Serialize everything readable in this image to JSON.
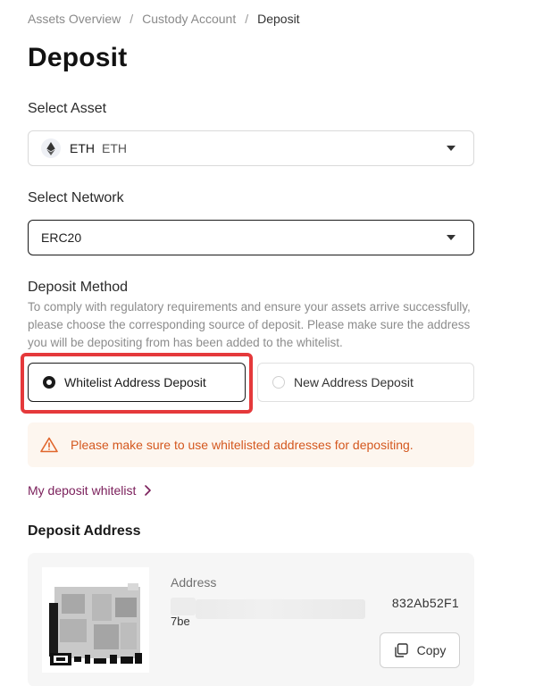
{
  "breadcrumb": {
    "items": [
      "Assets Overview",
      "Custody Account",
      "Deposit"
    ],
    "separator": "/"
  },
  "page": {
    "title": "Deposit"
  },
  "select_asset": {
    "label": "Select Asset",
    "symbol": "ETH",
    "name": "ETH",
    "icon": "ethereum-icon"
  },
  "select_network": {
    "label": "Select Network",
    "value": "ERC20"
  },
  "deposit_method": {
    "label": "Deposit Method",
    "description": "To comply with regulatory requirements and ensure your assets arrive successfully, please choose the corresponding source of deposit. Please make sure the address you will be depositing from has been added to the whitelist.",
    "options": [
      {
        "label": "Whitelist Address Deposit",
        "selected": true
      },
      {
        "label": "New Address Deposit",
        "selected": false
      }
    ]
  },
  "warning": {
    "text": "Please make sure to use whitelisted addresses for depositing.",
    "icon": "warning-triangle-icon",
    "color": "#d4581f"
  },
  "whitelist_link": {
    "label": "My deposit whitelist",
    "color": "#7a1e5a"
  },
  "deposit_address": {
    "title": "Deposit Address",
    "address_label": "Address",
    "address_visible_end": "832Ab52F1",
    "address_line2": "7be",
    "copy_label": "Copy"
  },
  "colors": {
    "highlight": "#e5393b",
    "warning_bg": "#fdf6ef"
  }
}
